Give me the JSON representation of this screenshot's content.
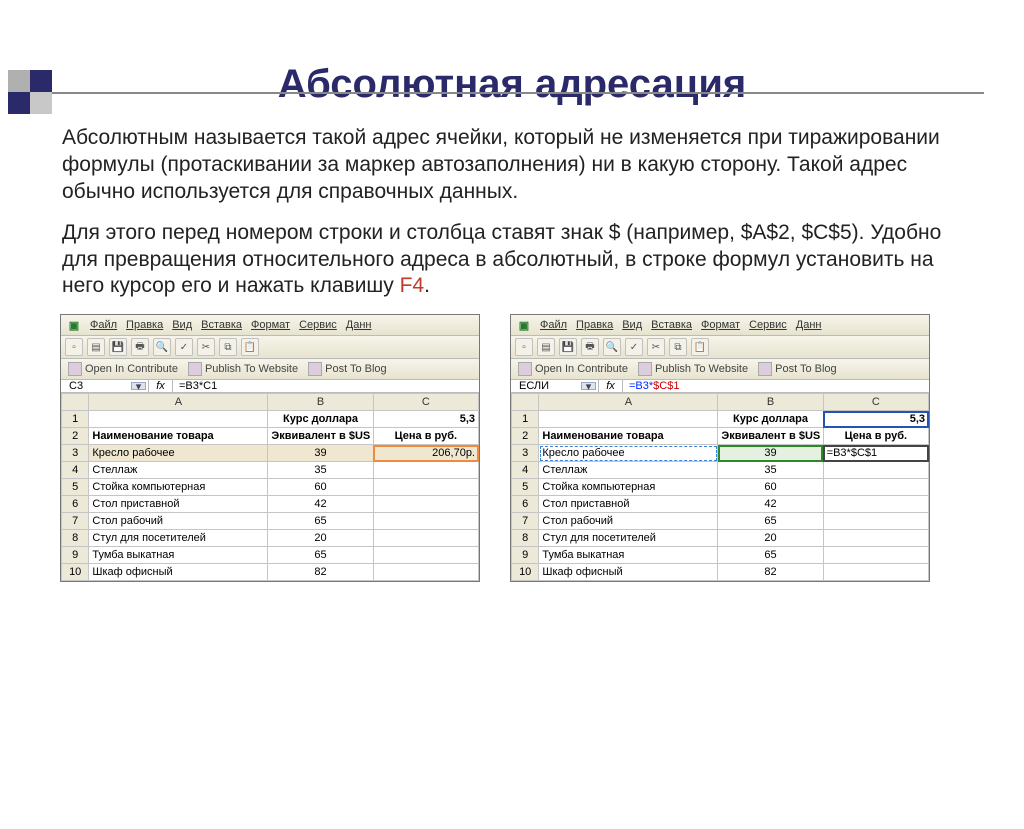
{
  "title": "Абсолютная адресация",
  "para1": "Абсолютным называется такой адрес ячейки, который не изменяется при тиражировании формулы (протаскивании за маркер автозаполнения) ни в какую сторону. Такой адрес обычно используется для справочных данных.",
  "para2_a": "Для этого перед номером строки и столбца ставят знак $ (например, $A$2, $C$5). Удобно для превращения относительного адреса в абсолютный, в строке формул установить на него курсор его и нажать клавишу  ",
  "para2_f4": "F4",
  "para2_b": ".",
  "menu": [
    "Файл",
    "Правка",
    "Вид",
    "Вставка",
    "Формат",
    "Сервис",
    "Данн"
  ],
  "contribute": {
    "open": "Open In Contribute",
    "publish": "Publish To Website",
    "post": "Post To Blog"
  },
  "left": {
    "namebox": "C3",
    "formula": "=B3*C1",
    "cols": [
      "A",
      "B",
      "C"
    ],
    "r1": {
      "b": "Курс доллара",
      "c": "5,3"
    },
    "r2": {
      "a": "Наименование товара",
      "b": "Эквивалент в $US",
      "c": "Цена в руб."
    },
    "rows": [
      {
        "n": "3",
        "a": "Кресло рабочее",
        "b": "39",
        "c": "206,70р."
      },
      {
        "n": "4",
        "a": "Стеллаж",
        "b": "35",
        "c": ""
      },
      {
        "n": "5",
        "a": "Стойка компьютерная",
        "b": "60",
        "c": ""
      },
      {
        "n": "6",
        "a": "Стол приставной",
        "b": "42",
        "c": ""
      },
      {
        "n": "7",
        "a": "Стол рабочий",
        "b": "65",
        "c": ""
      },
      {
        "n": "8",
        "a": "Стул для посетителей",
        "b": "20",
        "c": ""
      },
      {
        "n": "9",
        "a": "Тумба выкатная",
        "b": "65",
        "c": ""
      },
      {
        "n": "10",
        "a": "Шкаф офисный",
        "b": "82",
        "c": ""
      }
    ]
  },
  "right": {
    "namebox": "ЕСЛИ",
    "formula_a": "=B3*",
    "formula_b": "$C$1",
    "cols": [
      "A",
      "B",
      "C"
    ],
    "r1": {
      "b": "Курс доллара",
      "c": "5,3"
    },
    "r2": {
      "a": "Наименование товара",
      "b": "Эквивалент в $US",
      "c": "Цена в руб."
    },
    "rows": [
      {
        "n": "3",
        "a": "Кресло рабочее",
        "b": "39",
        "c": "=B3*$C$1"
      },
      {
        "n": "4",
        "a": "Стеллаж",
        "b": "35",
        "c": ""
      },
      {
        "n": "5",
        "a": "Стойка компьютерная",
        "b": "60",
        "c": ""
      },
      {
        "n": "6",
        "a": "Стол приставной",
        "b": "42",
        "c": ""
      },
      {
        "n": "7",
        "a": "Стол рабочий",
        "b": "65",
        "c": ""
      },
      {
        "n": "8",
        "a": "Стул для посетителей",
        "b": "20",
        "c": ""
      },
      {
        "n": "9",
        "a": "Тумба выкатная",
        "b": "65",
        "c": ""
      },
      {
        "n": "10",
        "a": "Шкаф офисный",
        "b": "82",
        "c": ""
      }
    ]
  }
}
